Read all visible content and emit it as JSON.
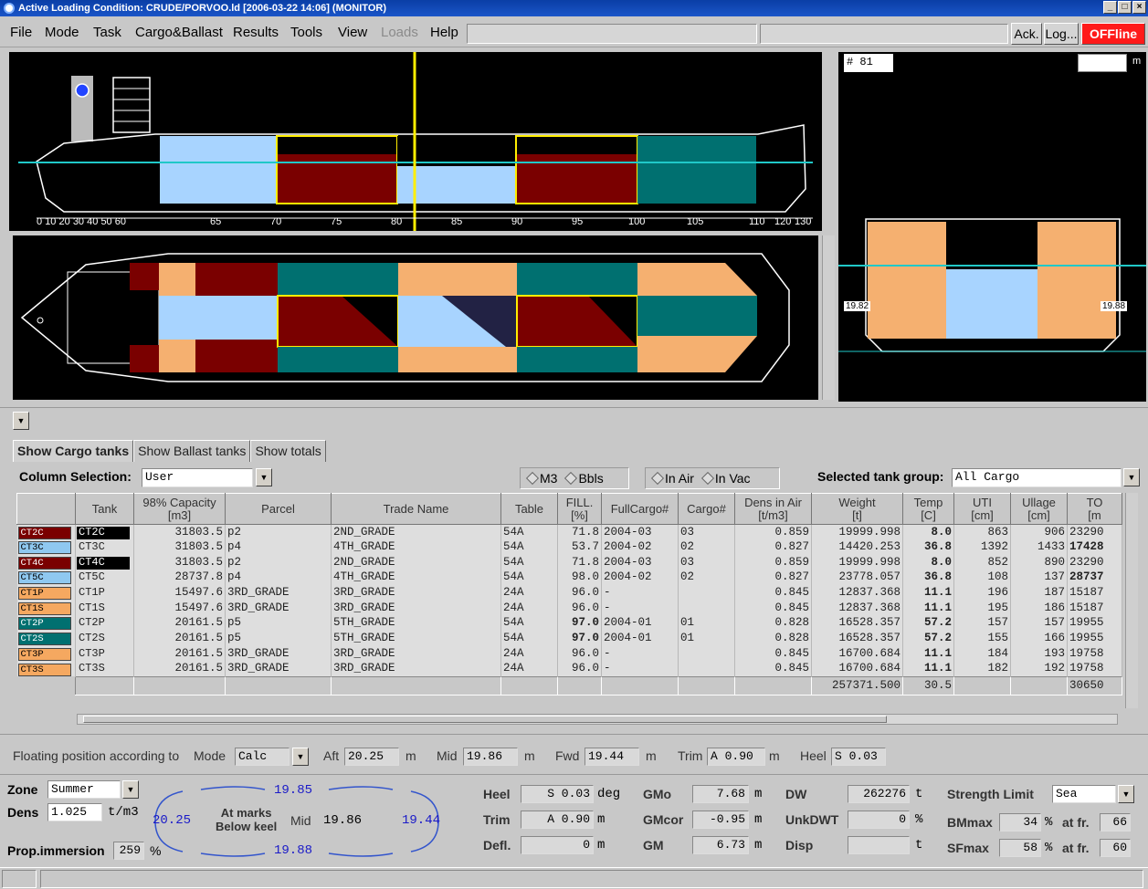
{
  "window": {
    "title": "Active Loading Condition: CRUDE/PORVOO.ld  [2006-03-22 14:06]  (MONITOR)"
  },
  "menu": [
    "File",
    "Mode",
    "Task",
    "Cargo&Ballast",
    "Results",
    "Tools",
    "View",
    "Loads",
    "Help"
  ],
  "toolbar": {
    "ack": "Ack.",
    "log": "Log...",
    "offline": "OFFline"
  },
  "views": {
    "frame_label": "#",
    "frame_value": "81",
    "section_unit": "m",
    "left_draft": "19.82",
    "right_draft": "19.88",
    "profile_scale_labels": [
      "0",
      "10",
      "20",
      "30",
      "40",
      "50",
      "60",
      "65",
      "70",
      "75",
      "80",
      "85",
      "90",
      "95",
      "100",
      "105",
      "110",
      "120",
      "130"
    ]
  },
  "tabs": [
    "Show Cargo tanks",
    "Show Ballast tanks",
    "Show totals"
  ],
  "column_selection": {
    "label": "Column Selection:",
    "value": "User"
  },
  "units_radio": [
    "M3",
    "Bbls"
  ],
  "air_radio": [
    "In Air",
    "In Vac"
  ],
  "tank_group": {
    "label": "Selected tank group:",
    "value": "All Cargo"
  },
  "table": {
    "headers": [
      "Tank",
      "98% Capacity\n[m3]",
      "Parcel",
      "Trade Name",
      "Table",
      "FILL.\n[%]",
      "FullCargo#",
      "Cargo#",
      "Dens in Air\n[t/m3]",
      "Weight\n[t]",
      "Temp\n[C]",
      "UTI\n[cm]",
      "Ullage\n[cm]",
      "TO\n[m"
    ],
    "rows": [
      {
        "tag": "CT2C",
        "tag_color": "#7a0000",
        "tank": "CT2C",
        "tank_sel": true,
        "cap": "31803.5",
        "parcel": "p2",
        "trade": "2ND_GRADE",
        "table": "54A",
        "fill": "71.8",
        "fill_b": false,
        "full": "2004-03",
        "cargo": "03",
        "dens": "0.859",
        "weight": "19999.998",
        "temp": "8.0",
        "uti": "863",
        "ullage": "906",
        "to": "23290"
      },
      {
        "tag": "CT3C",
        "tag_color": "#8fc8f0",
        "tank": "CT3C",
        "tank_sel": false,
        "cap": "31803.5",
        "parcel": "p4",
        "trade": "4TH_GRADE",
        "table": "54A",
        "fill": "53.7",
        "fill_b": false,
        "full": "2004-02",
        "cargo": "02",
        "dens": "0.827",
        "weight": "14420.253",
        "temp": "36.8",
        "uti": "1392",
        "ullage": "1433",
        "to": "17428"
      },
      {
        "tag": "CT4C",
        "tag_color": "#7a0000",
        "tank": "CT4C",
        "tank_sel": true,
        "cap": "31803.5",
        "parcel": "p2",
        "trade": "2ND_GRADE",
        "table": "54A",
        "fill": "71.8",
        "fill_b": false,
        "full": "2004-03",
        "cargo": "03",
        "dens": "0.859",
        "weight": "19999.998",
        "temp": "8.0",
        "uti": "852",
        "ullage": "890",
        "to": "23290"
      },
      {
        "tag": "CT5C",
        "tag_color": "#8fc8f0",
        "tank": "CT5C",
        "tank_sel": false,
        "cap": "28737.8",
        "parcel": "p4",
        "trade": "4TH_GRADE",
        "table": "54A",
        "fill": "98.0",
        "fill_b": false,
        "full": "2004-02",
        "cargo": "02",
        "dens": "0.827",
        "weight": "23778.057",
        "temp": "36.8",
        "uti": "108",
        "ullage": "137",
        "to": "28737"
      },
      {
        "tag": "CT1P",
        "tag_color": "#f5a860",
        "tank": "CT1P",
        "tank_sel": false,
        "cap": "15497.6",
        "parcel": "3RD_GRADE",
        "trade": "3RD_GRADE",
        "table": "24A",
        "fill": "96.0",
        "fill_b": false,
        "full": "-",
        "cargo": "",
        "dens": "0.845",
        "weight": "12837.368",
        "temp": "11.1",
        "uti": "196",
        "ullage": "187",
        "to": "15187"
      },
      {
        "tag": "CT1S",
        "tag_color": "#f5a860",
        "tank": "CT1S",
        "tank_sel": false,
        "cap": "15497.6",
        "parcel": "3RD_GRADE",
        "trade": "3RD_GRADE",
        "table": "24A",
        "fill": "96.0",
        "fill_b": false,
        "full": "-",
        "cargo": "",
        "dens": "0.845",
        "weight": "12837.368",
        "temp": "11.1",
        "uti": "195",
        "ullage": "186",
        "to": "15187"
      },
      {
        "tag": "CT2P",
        "tag_color": "#007070",
        "tank": "CT2P",
        "tank_sel": false,
        "cap": "20161.5",
        "parcel": "p5",
        "trade": "5TH_GRADE",
        "table": "54A",
        "fill": "97.0",
        "fill_b": true,
        "full": "2004-01",
        "cargo": "01",
        "dens": "0.828",
        "weight": "16528.357",
        "temp": "57.2",
        "uti": "157",
        "ullage": "157",
        "to": "19955"
      },
      {
        "tag": "CT2S",
        "tag_color": "#007070",
        "tank": "CT2S",
        "tank_sel": false,
        "cap": "20161.5",
        "parcel": "p5",
        "trade": "5TH_GRADE",
        "table": "54A",
        "fill": "97.0",
        "fill_b": true,
        "full": "2004-01",
        "cargo": "01",
        "dens": "0.828",
        "weight": "16528.357",
        "temp": "57.2",
        "uti": "155",
        "ullage": "166",
        "to": "19955"
      },
      {
        "tag": "CT3P",
        "tag_color": "#f5a860",
        "tank": "CT3P",
        "tank_sel": false,
        "cap": "20161.5",
        "parcel": "3RD_GRADE",
        "trade": "3RD_GRADE",
        "table": "24A",
        "fill": "96.0",
        "fill_b": false,
        "full": "-",
        "cargo": "",
        "dens": "0.845",
        "weight": "16700.684",
        "temp": "11.1",
        "uti": "184",
        "ullage": "193",
        "to": "19758"
      },
      {
        "tag": "CT3S",
        "tag_color": "#f5a860",
        "tank": "CT3S",
        "tank_sel": false,
        "cap": "20161.5",
        "parcel": "3RD_GRADE",
        "trade": "3RD_GRADE",
        "table": "24A",
        "fill": "96.0",
        "fill_b": false,
        "full": "-",
        "cargo": "",
        "dens": "0.845",
        "weight": "16700.684",
        "temp": "11.1",
        "uti": "182",
        "ullage": "192",
        "to": "19758"
      }
    ],
    "totals": {
      "weight": "257371.500",
      "temp": "30.5",
      "to": "30650"
    }
  },
  "floating": {
    "label": "Floating position according to",
    "mode_label": "Mode",
    "mode_value": "Calc",
    "aft_label": "Aft",
    "aft_value": "20.25",
    "aft_unit": "m",
    "mid_label": "Mid",
    "mid_value": "19.86",
    "mid_unit": "m",
    "fwd_label": "Fwd",
    "fwd_value": "19.44",
    "fwd_unit": "m",
    "trim_label": "Trim",
    "trim_value": "A 0.90",
    "trim_unit": "m",
    "heel_label": "Heel",
    "heel_value": "S 0.03"
  },
  "bottom": {
    "zone_label": "Zone",
    "zone_value": "Summer",
    "dens_label": "Dens",
    "dens_value": "1.025",
    "dens_unit": "t/m3",
    "prop_label": "Prop.immersion",
    "prop_value": "259",
    "prop_unit": "%",
    "marks_top": "19.85",
    "marks_left": "20.25",
    "marks_line1": "At marks",
    "marks_line2": "Below keel",
    "marks_mid_label": "Mid",
    "marks_mid": "19.86",
    "marks_right": "19.44",
    "marks_bottom": "19.88",
    "heel_label": "Heel",
    "heel_value": "S 0.03",
    "heel_unit": "deg",
    "trim_label": "Trim",
    "trim_value": "A 0.90",
    "trim_unit": "m",
    "defl_label": "Defl.",
    "defl_value": "0",
    "defl_unit": "m",
    "gmo_label": "GMo",
    "gmo_value": "7.68",
    "gmo_unit": "m",
    "gmcor_label": "GMcor",
    "gmcor_value": "-0.95",
    "gmcor_unit": "m",
    "gm_label": "GM",
    "gm_value": "6.73",
    "gm_unit": "m",
    "dw_label": "DW",
    "dw_value": "262276",
    "dw_unit": "t",
    "unkdwt_label": "UnkDWT",
    "unkdwt_value": "0",
    "unkdwt_unit": "%",
    "disp_label": "Disp",
    "disp_value": "",
    "disp_unit": "t",
    "strength_label": "Strength Limit",
    "strength_value": "Sea",
    "bm_label": "BMmax",
    "bm_value": "34",
    "bm_unit": "%",
    "bm_at": "at fr.",
    "bm_fr": "66",
    "sf_label": "SFmax",
    "sf_value": "58",
    "sf_unit": "%",
    "sf_at": "at fr.",
    "sf_fr": "60"
  }
}
